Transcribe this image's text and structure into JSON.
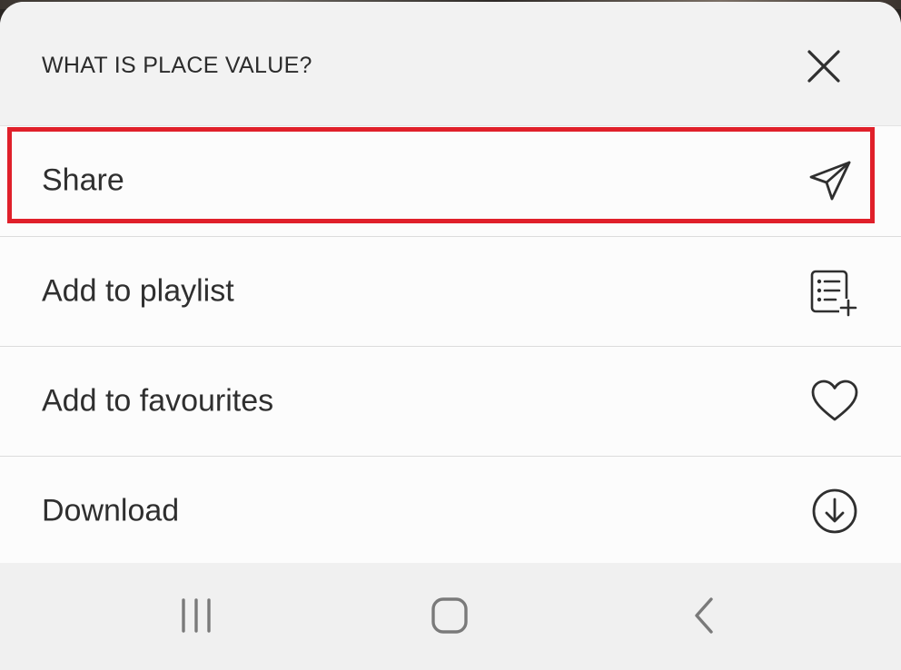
{
  "sheet": {
    "title": "WHAT IS PLACE VALUE?",
    "close_icon": "close-icon"
  },
  "menu": {
    "items": [
      {
        "label": "Share",
        "icon": "send-icon",
        "highlighted": true
      },
      {
        "label": "Add to playlist",
        "icon": "playlist-add-icon",
        "highlighted": false
      },
      {
        "label": "Add to favourites",
        "icon": "heart-icon",
        "highlighted": false
      },
      {
        "label": "Download",
        "icon": "download-icon",
        "highlighted": false
      }
    ]
  },
  "navigation_bar": {
    "buttons": [
      {
        "name": "recent-apps",
        "icon": "recent-apps-icon"
      },
      {
        "name": "home",
        "icon": "home-icon"
      },
      {
        "name": "back",
        "icon": "back-icon"
      }
    ]
  },
  "colors": {
    "highlight": "#e0202a",
    "sheet_background": "#f2f2f2",
    "list_background": "#fcfcfc",
    "text": "#2f2f2f"
  }
}
